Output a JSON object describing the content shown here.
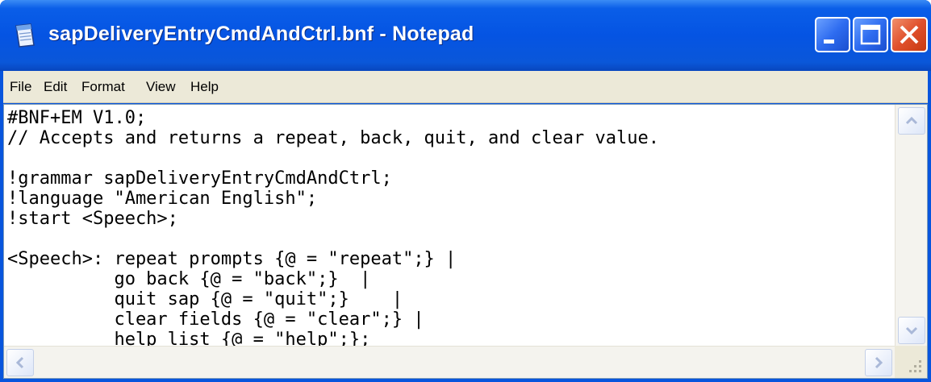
{
  "window": {
    "title": "sapDeliveryEntryCmdAndCtrl.bnf - Notepad",
    "icon": "notepad-icon",
    "titlebar_color": "#0554e3",
    "close_color": "#e0502c"
  },
  "menu": {
    "items": [
      {
        "label": "File"
      },
      {
        "label": "Edit"
      },
      {
        "label": "Format"
      },
      {
        "label": "View"
      },
      {
        "label": "Help"
      }
    ]
  },
  "editor": {
    "lines": [
      "#BNF+EM V1.0;",
      "// Accepts and returns a repeat, back, quit, and clear value.",
      "",
      "!grammar sapDeliveryEntryCmdAndCtrl;",
      "!language \"American English\";",
      "!start <Speech>;",
      "",
      "<Speech>: repeat prompts {@ = \"repeat\";} |",
      "          go back {@ = \"back\";}  |",
      "          quit sap {@ = \"quit\";}    |",
      "          clear fields {@ = \"clear\";} |",
      "          help list {@ = \"help\";};"
    ]
  },
  "icons": {
    "minimize": "minimize-icon",
    "maximize": "maximize-icon",
    "close": "close-icon",
    "scroll_up": "arrow-up-icon",
    "scroll_down": "arrow-down-icon",
    "scroll_left": "arrow-left-icon",
    "scroll_right": "arrow-right-icon"
  }
}
